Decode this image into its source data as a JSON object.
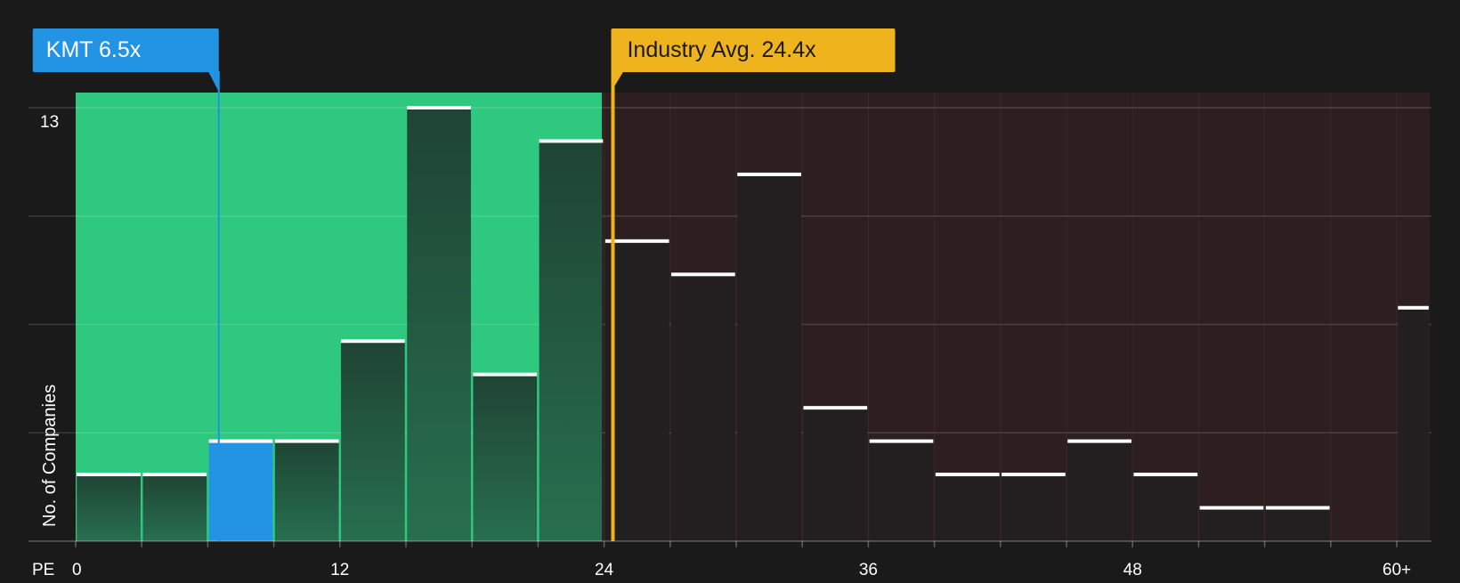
{
  "chart_data": {
    "type": "bar",
    "x_axis_label": "PE",
    "ylabel": "No. of Companies",
    "y_tick_labels": [
      {
        "value": 13,
        "label": "13"
      }
    ],
    "ylim": [
      0,
      13
    ],
    "x_tick_labels": [
      {
        "value": 0,
        "label": "0"
      },
      {
        "value": 12,
        "label": "12"
      },
      {
        "value": 24,
        "label": "24"
      },
      {
        "value": 36,
        "label": "36"
      },
      {
        "value": 48,
        "label": "48"
      },
      {
        "value": 60,
        "label": "60+"
      }
    ],
    "xlim": [
      0,
      61.5
    ],
    "bin_width": 3,
    "bins": [
      {
        "start": 0,
        "end": 3,
        "count": 2
      },
      {
        "start": 3,
        "end": 6,
        "count": 2
      },
      {
        "start": 6,
        "end": 9,
        "count": 3,
        "highlight": true
      },
      {
        "start": 9,
        "end": 12,
        "count": 3
      },
      {
        "start": 12,
        "end": 15,
        "count": 6
      },
      {
        "start": 15,
        "end": 18,
        "count": 13
      },
      {
        "start": 18,
        "end": 21,
        "count": 5
      },
      {
        "start": 21,
        "end": 24,
        "count": 12
      },
      {
        "start": 24,
        "end": 27,
        "count": 9
      },
      {
        "start": 27,
        "end": 30,
        "count": 8
      },
      {
        "start": 30,
        "end": 33,
        "count": 11
      },
      {
        "start": 33,
        "end": 36,
        "count": 4
      },
      {
        "start": 36,
        "end": 39,
        "count": 3
      },
      {
        "start": 39,
        "end": 42,
        "count": 2
      },
      {
        "start": 42,
        "end": 45,
        "count": 2
      },
      {
        "start": 45,
        "end": 48,
        "count": 3
      },
      {
        "start": 48,
        "end": 51,
        "count": 2
      },
      {
        "start": 51,
        "end": 54,
        "count": 1
      },
      {
        "start": 54,
        "end": 57,
        "count": 1
      },
      {
        "start": 60,
        "end": 61.5,
        "count": 7
      }
    ],
    "markers": [
      {
        "id": "company",
        "label": "KMT 6.5x",
        "value": 6.5,
        "color": "#2394e3"
      },
      {
        "id": "industry",
        "label": "Industry Avg. 24.4x",
        "value": 24.4,
        "color": "#efb41d"
      }
    ],
    "regions": [
      {
        "id": "undervalued",
        "from": 0,
        "to": 23.9,
        "color": "#2ec87f"
      },
      {
        "id": "overvalued",
        "from": 23.9,
        "to": 61.5,
        "color": "#2d1f20"
      }
    ],
    "colors": {
      "background": "#1a1a1b",
      "bar_default": "#1e4a36",
      "bar_over": "#231f20",
      "bar_highlight": "#2394e3",
      "bar_cap": "#ffffff",
      "grid": "#ffffff",
      "axis_text": "#ffffff"
    }
  }
}
